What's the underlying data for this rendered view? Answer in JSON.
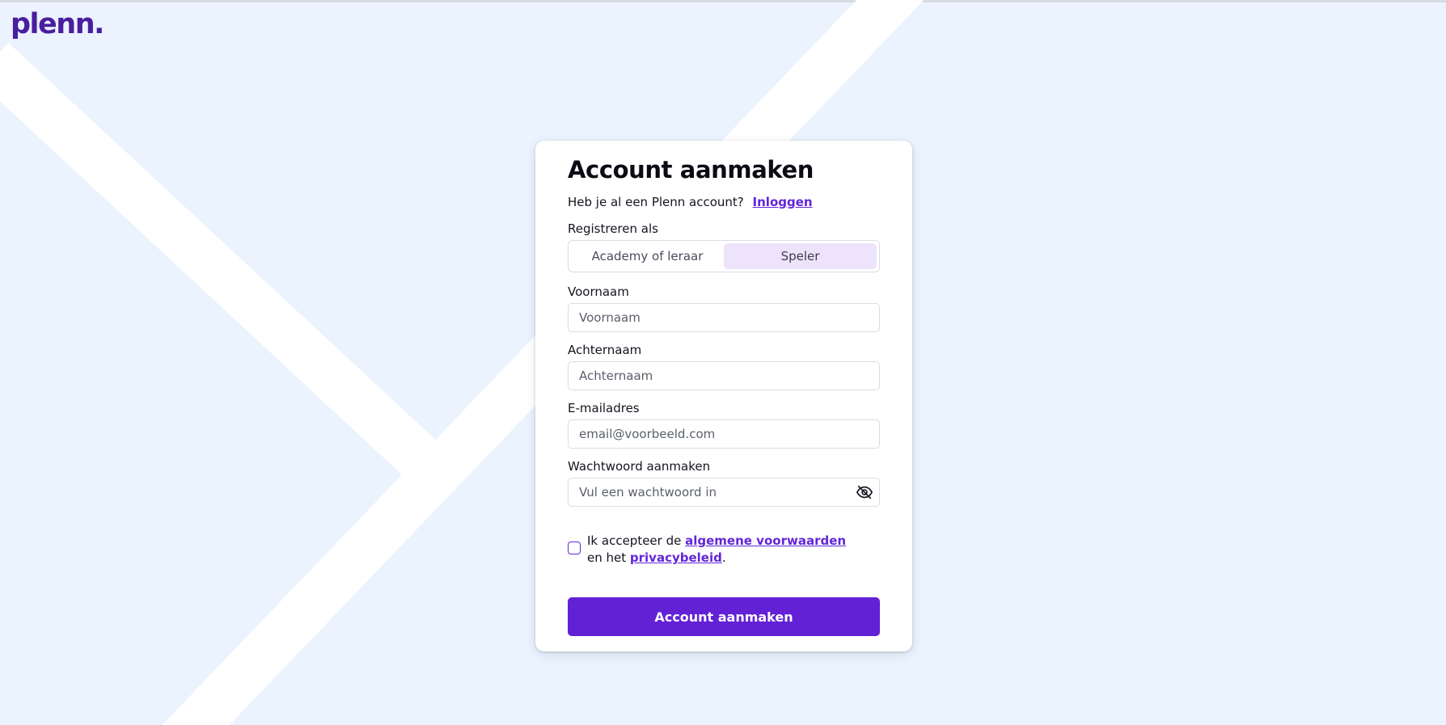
{
  "brand": {
    "logo_text": "plenn."
  },
  "form": {
    "title": "Account aanmaken",
    "have_account_text": "Heb je al een Plenn account?",
    "login_link": "Inloggen",
    "register_as_label": "Registreren als",
    "register_options": [
      {
        "label": "Academy of leraar",
        "selected": false
      },
      {
        "label": "Speler",
        "selected": true
      }
    ],
    "first_name": {
      "label": "Voornaam",
      "placeholder": "Voornaam",
      "value": ""
    },
    "last_name": {
      "label": "Achternaam",
      "placeholder": "Achternaam",
      "value": ""
    },
    "email": {
      "label": "E-mailadres",
      "placeholder": "email@voorbeeld.com",
      "value": ""
    },
    "password": {
      "label": "Wachtwoord aanmaken",
      "placeholder": "Vul een wachtwoord in",
      "value": "",
      "toggle_icon": "eye-off-icon"
    },
    "terms": {
      "checked": false,
      "prefix": "Ik accepteer de",
      "terms_link": "algemene voorwaarden",
      "middle": "en het",
      "privacy_link": "privacybeleid",
      "suffix": "."
    },
    "submit_label": "Account aanmaken"
  },
  "colors": {
    "background": "#eaf3fe",
    "accent": "#6321d6",
    "logo": "#4a1e9e",
    "selected_segment": "#ede4fb"
  }
}
